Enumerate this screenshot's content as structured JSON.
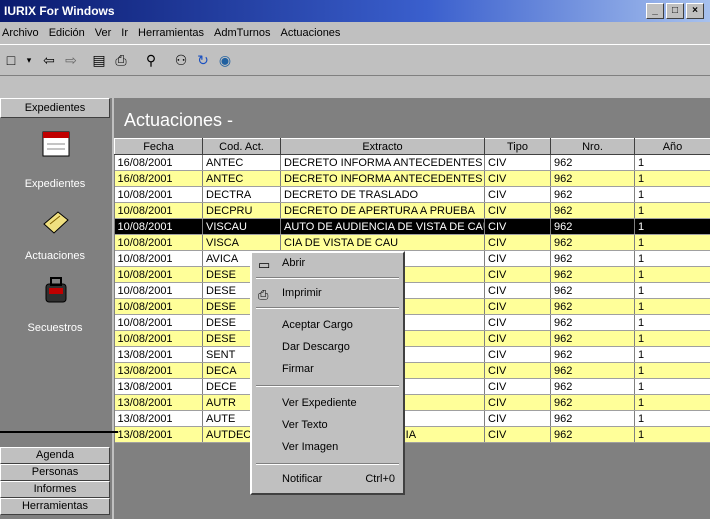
{
  "window": {
    "title": "IURIX For Windows",
    "minimize": "_",
    "maximize": "□",
    "close": "×"
  },
  "menu": [
    "Archivo",
    "Edición",
    "Ver",
    "Ir",
    "Herramientas",
    "AdmTurnos",
    "Actuaciones"
  ],
  "toolbar": {
    "icons": [
      "new-icon",
      "back-icon",
      "forward-icon",
      "document-icon",
      "print-icon",
      "search-icon",
      "find-icon",
      "refresh-icon",
      "globe-icon"
    ]
  },
  "sidebar": {
    "header": "Expedientes",
    "items": [
      {
        "label": "Expedientes",
        "icon": "calendar-icon"
      },
      {
        "label": "Actuaciones",
        "icon": "notepad-icon"
      },
      {
        "label": "Secuestros",
        "icon": "bag-icon"
      }
    ],
    "buttons": [
      "Agenda",
      "Personas",
      "Informes",
      "Herramientas"
    ]
  },
  "main": {
    "title": "Actuaciones -",
    "columns": [
      "Fecha",
      "Cod. Act.",
      "Extracto",
      "Tipo",
      "Nro.",
      "Año"
    ],
    "rows": [
      {
        "fecha": "16/08/2001",
        "cod": "ANTEC",
        "extracto": "DECRETO INFORMA ANTECEDENTES D",
        "tipo": "CIV",
        "nro": "962",
        "anio": "1",
        "style": "w"
      },
      {
        "fecha": "16/08/2001",
        "cod": "ANTEC",
        "extracto": "DECRETO INFORMA ANTECEDENTES",
        "tipo": "CIV",
        "nro": "962",
        "anio": "1",
        "style": "y"
      },
      {
        "fecha": "10/08/2001",
        "cod": "DECTRA",
        "extracto": "DECRETO DE TRASLADO",
        "tipo": "CIV",
        "nro": "962",
        "anio": "1",
        "style": "w"
      },
      {
        "fecha": "10/08/2001",
        "cod": "DECPRU",
        "extracto": "DECRETO DE APERTURA A PRUEBA",
        "tipo": "CIV",
        "nro": "962",
        "anio": "1",
        "style": "y"
      },
      {
        "fecha": "10/08/2001",
        "cod": "VISCAU",
        "extracto": "AUTO DE AUDIENCIA DE VISTA DE CAU",
        "tipo": "CIV",
        "nro": "962",
        "anio": "1",
        "style": "sel"
      },
      {
        "fecha": "10/08/2001",
        "cod": "VISCA",
        "extracto": "CIA DE VISTA DE CAU",
        "tipo": "CIV",
        "nro": "962",
        "anio": "1",
        "style": "y"
      },
      {
        "fecha": "10/08/2001",
        "cod": "AVICA",
        "extracto": "AUSA",
        "tipo": "CIV",
        "nro": "962",
        "anio": "1",
        "style": "w"
      },
      {
        "fecha": "10/08/2001",
        "cod": "DESE",
        "extracto": "OLVER SENTEN. 60 D",
        "tipo": "CIV",
        "nro": "962",
        "anio": "1",
        "style": "y"
      },
      {
        "fecha": "10/08/2001",
        "cod": "DESE",
        "extracto": "OLVER SENTEN. 20 D",
        "tipo": "CIV",
        "nro": "962",
        "anio": "1",
        "style": "w"
      },
      {
        "fecha": "10/08/2001",
        "cod": "DESE",
        "extracto": "OLVER SENTEN 10 D",
        "tipo": "CIV",
        "nro": "962",
        "anio": "1",
        "style": "y"
      },
      {
        "fecha": "10/08/2001",
        "cod": "DESE",
        "extracto": "OLVER SENTEN. 8 D",
        "tipo": "CIV",
        "nro": "962",
        "anio": "1",
        "style": "w"
      },
      {
        "fecha": "10/08/2001",
        "cod": "DESE",
        "extracto": "OLVER SENTENCIA",
        "tipo": "CIV",
        "nro": "962",
        "anio": "1",
        "style": "y"
      },
      {
        "fecha": "13/08/2001",
        "cod": "SENT",
        "extracto": "",
        "tipo": "CIV",
        "nro": "962",
        "anio": "1",
        "style": "w"
      },
      {
        "fecha": "13/08/2001",
        "cod": "DECA",
        "extracto": "O",
        "tipo": "CIV",
        "nro": "962",
        "anio": "1",
        "style": "y"
      },
      {
        "fecha": "13/08/2001",
        "cod": "DECE",
        "extracto": "VESE'",
        "tipo": "CIV",
        "nro": "962",
        "anio": "1",
        "style": "w"
      },
      {
        "fecha": "13/08/2001",
        "cod": "AUTR",
        "extracto": "CION",
        "tipo": "CIV",
        "nro": "962",
        "anio": "1",
        "style": "y"
      },
      {
        "fecha": "13/08/2001",
        "cod": "AUTE",
        "extracto": "CION",
        "tipo": "CIV",
        "nro": "962",
        "anio": "1",
        "style": "w"
      },
      {
        "fecha": "13/08/2001",
        "cod": "AUTDEC",
        "extracto": "AUTO DE DECLINATORIA",
        "tipo": "CIV",
        "nro": "962",
        "anio": "1",
        "style": "y"
      }
    ]
  },
  "context_menu": {
    "items": [
      {
        "label": "Abrir",
        "icon": "open-icon"
      },
      {
        "label": "Imprimir",
        "icon": "print-icon"
      },
      {
        "label": "Aceptar Cargo"
      },
      {
        "label": "Dar Descargo"
      },
      {
        "label": "Firmar"
      },
      {
        "label": "Ver Expediente"
      },
      {
        "label": "Ver Texto"
      },
      {
        "label": "Ver Imagen"
      },
      {
        "label": "Notificar",
        "shortcut": "Ctrl+0"
      }
    ]
  },
  "colors": {
    "row_yellow": "#ffff99",
    "selected": "#000000",
    "titlebar": "#0a1a6e"
  }
}
